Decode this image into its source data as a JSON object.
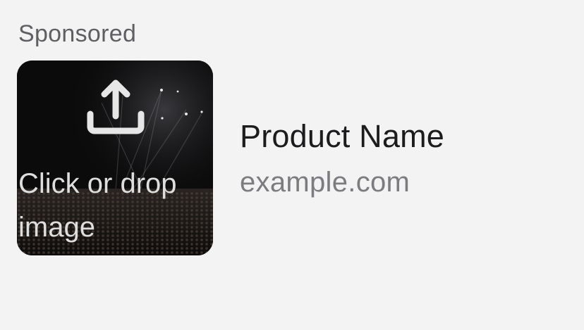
{
  "ad": {
    "sponsored_label": "Sponsored",
    "image_drop_text": "Click or drop image",
    "product_name": "Product Name",
    "product_url": "example.com"
  },
  "icons": {
    "upload": "upload-icon"
  },
  "colors": {
    "background": "#f3f3f3",
    "sponsored_text": "#5f5f63",
    "product_name_text": "#1c1c1e",
    "url_text": "#7b7b80",
    "overlay_text": "#dedede"
  }
}
